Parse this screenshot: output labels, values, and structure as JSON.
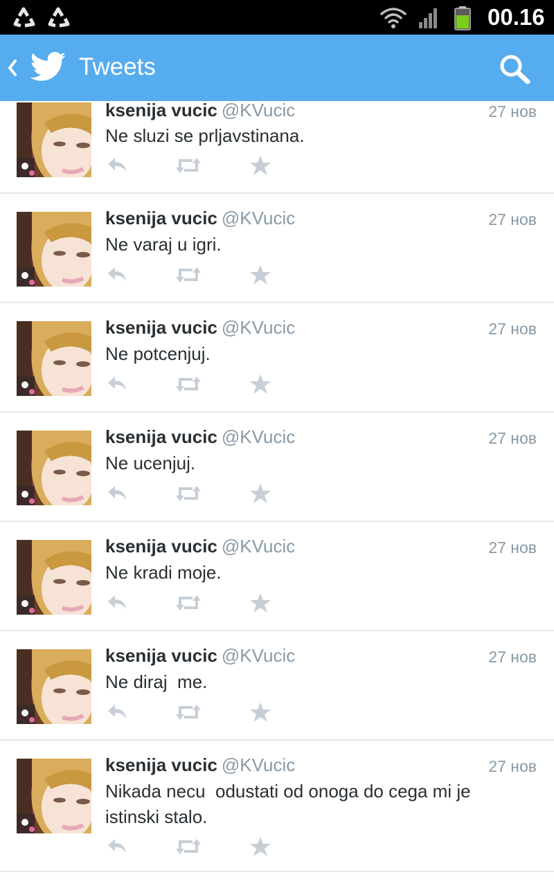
{
  "status_bar": {
    "left_icons": [
      "recycle-icon",
      "recycle-icon"
    ],
    "right_icons": [
      "wifi-icon",
      "signal-icon",
      "battery-icon"
    ],
    "time": "00.16"
  },
  "app_bar": {
    "title": "Tweets",
    "back_icon": "chevron-left-icon",
    "logo_icon": "twitter-bird-icon",
    "search_icon": "search-icon",
    "color": "#55acee"
  },
  "tweets": [
    {
      "name": "ksenija vucic",
      "handle": "@KVucic",
      "time": "27 нов",
      "text": "Ne sluzi se prljavstinana."
    },
    {
      "name": "ksenija vucic",
      "handle": "@KVucic",
      "time": "27 нов",
      "text": "Ne varaj u igri."
    },
    {
      "name": "ksenija vucic",
      "handle": "@KVucic",
      "time": "27 нов",
      "text": "Ne potcenjuj."
    },
    {
      "name": "ksenija vucic",
      "handle": "@KVucic",
      "time": "27 нов",
      "text": "Ne ucenjuj."
    },
    {
      "name": "ksenija vucic",
      "handle": "@KVucic",
      "time": "27 нов",
      "text": "Ne kradi moje."
    },
    {
      "name": "ksenija vucic",
      "handle": "@KVucic",
      "time": "27 нов",
      "text": "Ne diraj  me."
    },
    {
      "name": "ksenija vucic",
      "handle": "@KVucic",
      "time": "27 нов",
      "text": "Nikada necu  odustati od onoga do cega mi je istinski stalo."
    }
  ],
  "tweet_actions": [
    "reply-icon",
    "retweet-icon",
    "favorite-star-icon"
  ],
  "colors": {
    "accent": "#55acee",
    "text": "#292f33",
    "muted": "#8899a6",
    "icon": "#c7ced6",
    "divider": "#e4e6e8"
  }
}
